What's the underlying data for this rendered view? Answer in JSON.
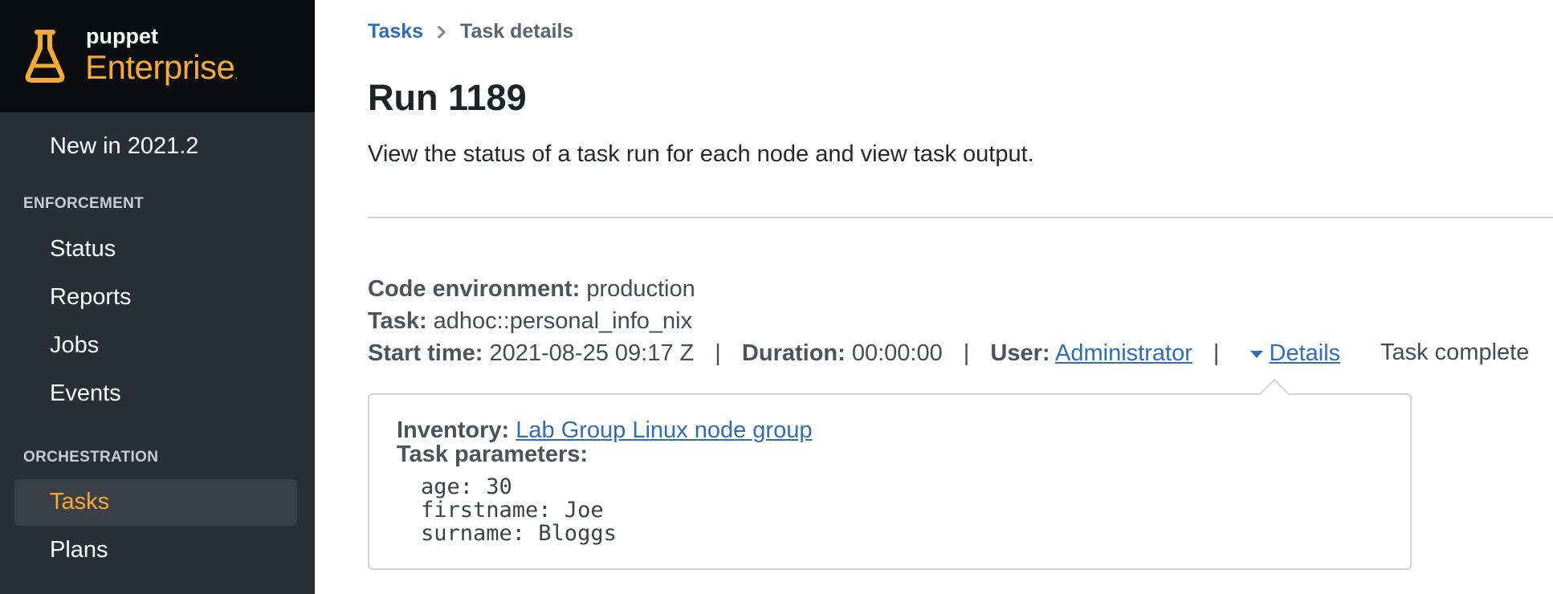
{
  "brand": {
    "small": "puppet",
    "large": "Enterprise",
    "mark": "."
  },
  "sidebar": {
    "top_item": "New in 2021.2",
    "sections": [
      {
        "title": "ENFORCEMENT",
        "items": [
          "Status",
          "Reports",
          "Jobs",
          "Events"
        ]
      },
      {
        "title": "ORCHESTRATION",
        "items": [
          "Tasks",
          "Plans"
        ]
      }
    ],
    "active_item": "Tasks"
  },
  "breadcrumb": {
    "link": "Tasks",
    "current": "Task details"
  },
  "page": {
    "title": "Run 1189",
    "description": "View the status of a task run for each node and view task output."
  },
  "run": {
    "code_env_label": "Code environment:",
    "code_env_value": "production",
    "task_label": "Task:",
    "task_value": "adhoc::personal_info_nix",
    "start_label": "Start time:",
    "start_value": "2021-08-25 09:17 Z",
    "duration_label": "Duration:",
    "duration_value": "00:00:00",
    "user_label": "User:",
    "user_value": "Administrator",
    "separator": "|",
    "details_label": "Details",
    "status": "Task complete"
  },
  "details": {
    "inventory_label": "Inventory:",
    "inventory_value": "Lab Group Linux node group",
    "params_label": "Task parameters:",
    "params": [
      "age: 30",
      "firstname: Joe",
      "surname: Bloggs"
    ]
  },
  "colors": {
    "sidebar_bg": "#2a2f35",
    "brand_bg": "#0b0d10",
    "accent": "#f6a935",
    "link": "#2f6db5"
  }
}
